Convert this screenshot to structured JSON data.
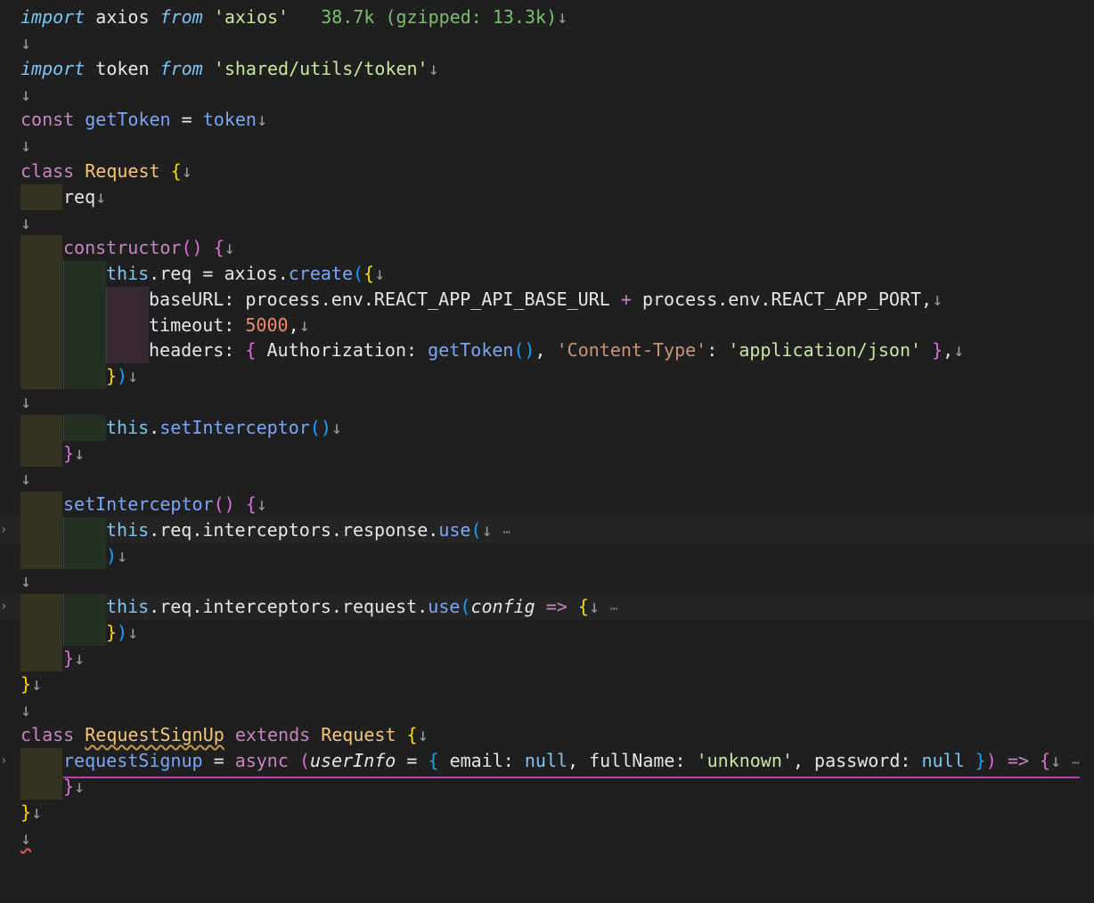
{
  "import_size_hint": "38.7k (gzipped: 13.3k)",
  "colors": {
    "background": "#1f1f1f",
    "keyword": "#c586c0",
    "import_keyword": "#7ec6f0",
    "string": "#cbe6a3",
    "number": "#f08a6e",
    "class_name": "#f5c57a",
    "function": "#7aa6f5",
    "bracket_gold": "#ffd700",
    "bracket_purple": "#da70d6",
    "hint": "#7bbf6e"
  },
  "icons": {
    "newline_marker": "↓",
    "fold_marker": "›",
    "ellipsis": "⋯"
  },
  "tokens": {
    "import": "import",
    "from": "from",
    "const": "const",
    "class": "class",
    "extends": "extends",
    "async": "async",
    "this": "this",
    "null": "null",
    "axios_id": "axios",
    "axios_str": "'axios'",
    "token_id": "token",
    "token_path": "'shared/utils/token'",
    "getToken": "getToken",
    "Request": "Request",
    "req": "req",
    "constructor": "constructor",
    "create": "create",
    "baseURL": "baseURL",
    "process": "process",
    "env": "env",
    "api_base_url": "REACT_APP_API_BASE_URL",
    "port": "REACT_APP_PORT",
    "timeout": "timeout",
    "timeout_val": "5000",
    "headers": "headers",
    "Authorization": "Authorization",
    "content_type_key": "'Content-Type'",
    "content_type_val": "'application/json'",
    "setInterceptor": "setInterceptor",
    "interceptors": "interceptors",
    "response": "response",
    "request": "request",
    "use": "use",
    "config": "config",
    "RequestSignUp": "RequestSignUp",
    "requestSignup": "requestSignup",
    "userInfo": "userInfo",
    "email": "email",
    "fullName": "fullName",
    "unknown": "'unknown'",
    "password": "password"
  }
}
